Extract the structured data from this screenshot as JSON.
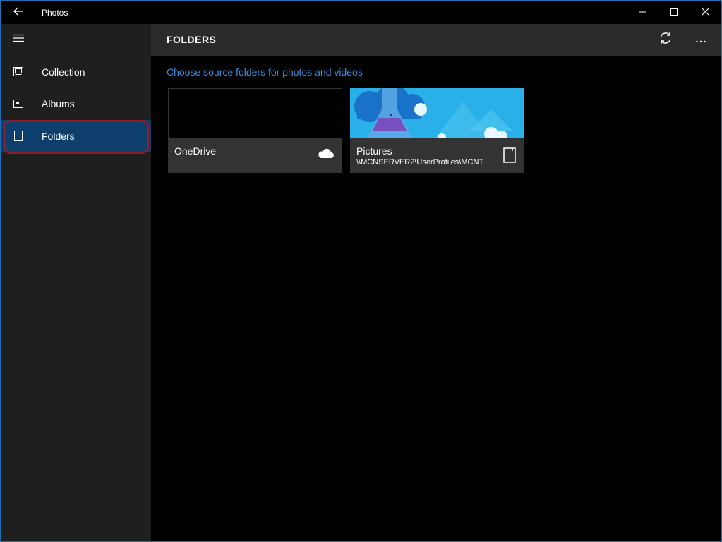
{
  "window": {
    "title": "Photos"
  },
  "sidebar": {
    "items": [
      {
        "label": "Collection",
        "icon": "collection-icon"
      },
      {
        "label": "Albums",
        "icon": "albums-icon"
      },
      {
        "label": "Folders",
        "icon": "folder-icon",
        "selected": true
      }
    ]
  },
  "main": {
    "title": "FOLDERS",
    "subtitle": "Choose source folders for photos and videos",
    "folders": [
      {
        "name": "OneDrive",
        "path": "",
        "icon": "cloud-icon"
      },
      {
        "name": "Pictures",
        "path": "\\\\MCNSERVER2\\UserProfiles\\MCNT...",
        "icon": "device-icon"
      }
    ]
  },
  "colors": {
    "accent": "#3b8fe0",
    "selected_bg": "#0e3f6c",
    "highlight_ring": "#8b1d2c",
    "sidebar_bg": "#1f1f1f",
    "header_bg": "#2b2b2b",
    "tile_bg": "#333333"
  }
}
